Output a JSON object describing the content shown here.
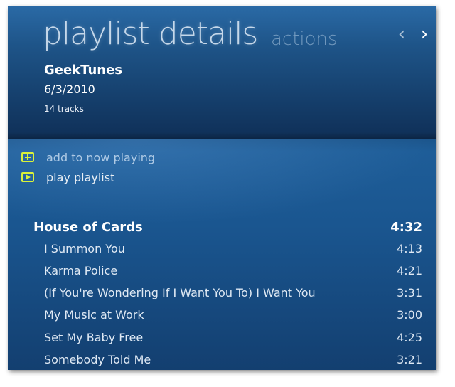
{
  "header": {
    "title": "playlist details",
    "subtitle": "actions",
    "nav_prev_icon": "chevron-left-icon",
    "nav_next_icon": "chevron-right-icon"
  },
  "playlist": {
    "name": "GeekTunes",
    "date": "6/3/2010",
    "track_count": "14 tracks"
  },
  "actions": [
    {
      "label": "add to now playing",
      "icon": "add-icon"
    },
    {
      "label": "play playlist",
      "icon": "play-icon"
    }
  ],
  "tracks": [
    {
      "title": "House of Cards",
      "duration": "4:32",
      "current": true
    },
    {
      "title": "I Summon You",
      "duration": "4:13"
    },
    {
      "title": "Karma Police",
      "duration": "4:21"
    },
    {
      "title": "(If You're Wondering If I Want You To) I Want You",
      "duration": "3:31"
    },
    {
      "title": "My Music at Work",
      "duration": "3:00"
    },
    {
      "title": "Set My Baby Free",
      "duration": "4:25"
    },
    {
      "title": "Somebody Told Me",
      "duration": "3:21"
    }
  ],
  "colors": {
    "accent": "#d9f23a",
    "background": "#1a4f82",
    "text": "#ffffff"
  }
}
